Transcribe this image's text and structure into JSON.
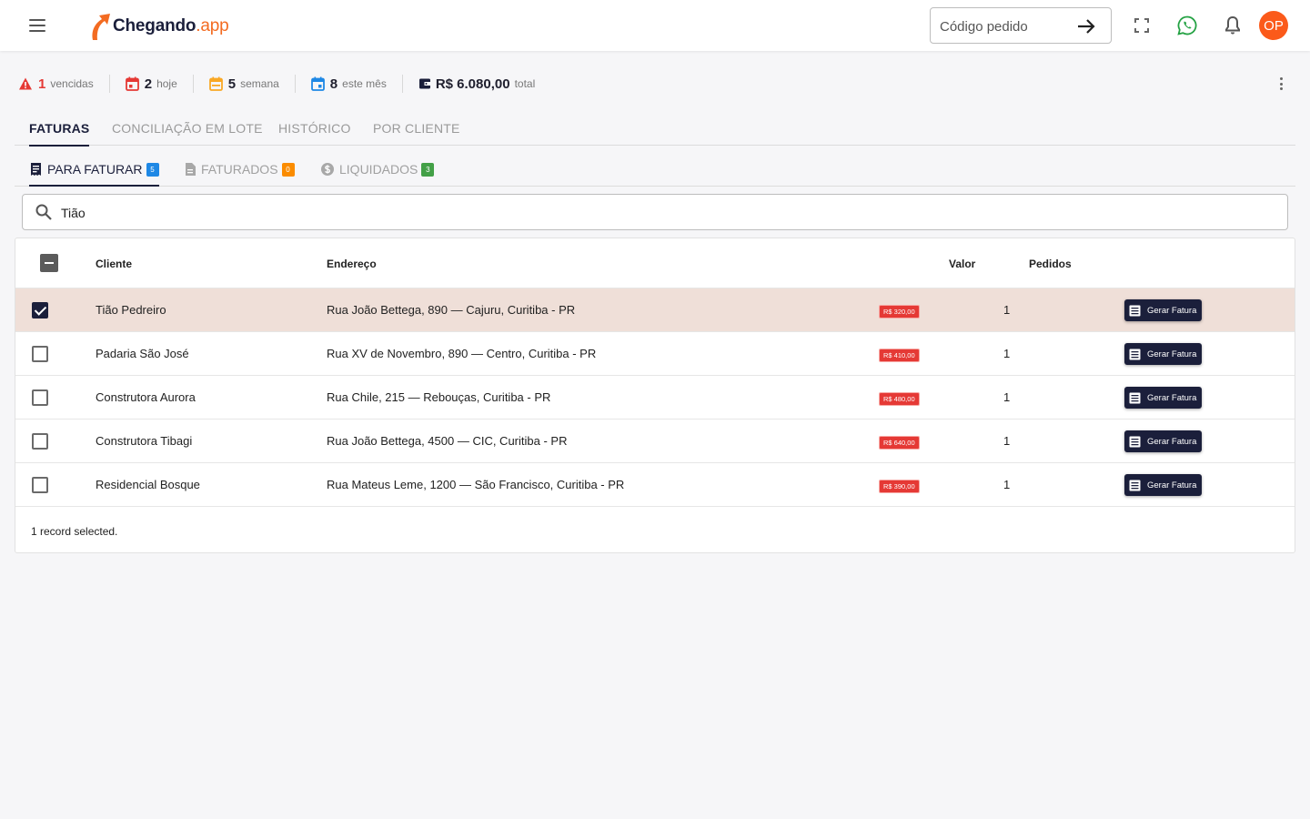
{
  "header": {
    "logo_main": "Chegando",
    "logo_suffix": ".app",
    "code_placeholder": "Código pedido",
    "avatar_initials": "OP"
  },
  "stats": [
    {
      "value": "1",
      "label": "vencidas",
      "color": "#e53935",
      "icon": "warning-icon"
    },
    {
      "value": "2",
      "label": "hoje",
      "color": "#e53935",
      "icon": "calendar-today-icon"
    },
    {
      "value": "5",
      "label": "semana",
      "color": "#f9a825",
      "icon": "calendar-week-icon"
    },
    {
      "value": "8",
      "label": "este mês",
      "color": "#1e88e5",
      "icon": "calendar-month-icon"
    },
    {
      "value": "R$ 6.080,00",
      "label": "total",
      "color": "#1b1f3b",
      "icon": "wallet-icon"
    }
  ],
  "main_tabs": [
    {
      "label": "FATURAS",
      "active": true
    },
    {
      "label": "CONCILIAÇÃO EM LOTE",
      "active": false
    },
    {
      "label": "HISTÓRICO",
      "active": false
    },
    {
      "label": "POR CLIENTE",
      "active": false
    }
  ],
  "sub_tabs": [
    {
      "label": "PARA FATURAR",
      "badge": "5",
      "badge_color": "#1e88e5",
      "active": true,
      "icon": "invoice-icon"
    },
    {
      "label": "FATURADOS",
      "badge": "0",
      "badge_color": "#fb8c00",
      "active": false,
      "icon": "document-icon"
    },
    {
      "label": "LIQUIDADOS",
      "badge": "3",
      "badge_color": "#43a047",
      "active": false,
      "icon": "dollar-icon"
    }
  ],
  "search": {
    "value": "Tião"
  },
  "table": {
    "columns": {
      "cliente": "Cliente",
      "endereco": "Endereço",
      "valor": "Valor",
      "pedidos": "Pedidos"
    },
    "action_label": "Gerar Fatura",
    "rows": [
      {
        "cliente": "Tião Pedreiro",
        "endereco": "Rua João Bettega, 890 — Cajuru, Curitiba - PR",
        "valor": "R$ 320,00",
        "pedidos": "1",
        "selected": true
      },
      {
        "cliente": "Padaria São José",
        "endereco": "Rua XV de Novembro, 890 — Centro, Curitiba - PR",
        "valor": "R$ 410,00",
        "pedidos": "1",
        "selected": false
      },
      {
        "cliente": "Construtora Aurora",
        "endereco": "Rua Chile, 215 — Rebouças, Curitiba - PR",
        "valor": "R$ 480,00",
        "pedidos": "1",
        "selected": false
      },
      {
        "cliente": "Construtora Tibagi",
        "endereco": "Rua João Bettega, 4500 — CIC, Curitiba - PR",
        "valor": "R$ 640,00",
        "pedidos": "1",
        "selected": false
      },
      {
        "cliente": "Residencial Bosque",
        "endereco": "Rua Mateus Leme, 1200 — São Francisco, Curitiba - PR",
        "valor": "R$ 390,00",
        "pedidos": "1",
        "selected": false
      }
    ],
    "footer": "1 record selected."
  }
}
